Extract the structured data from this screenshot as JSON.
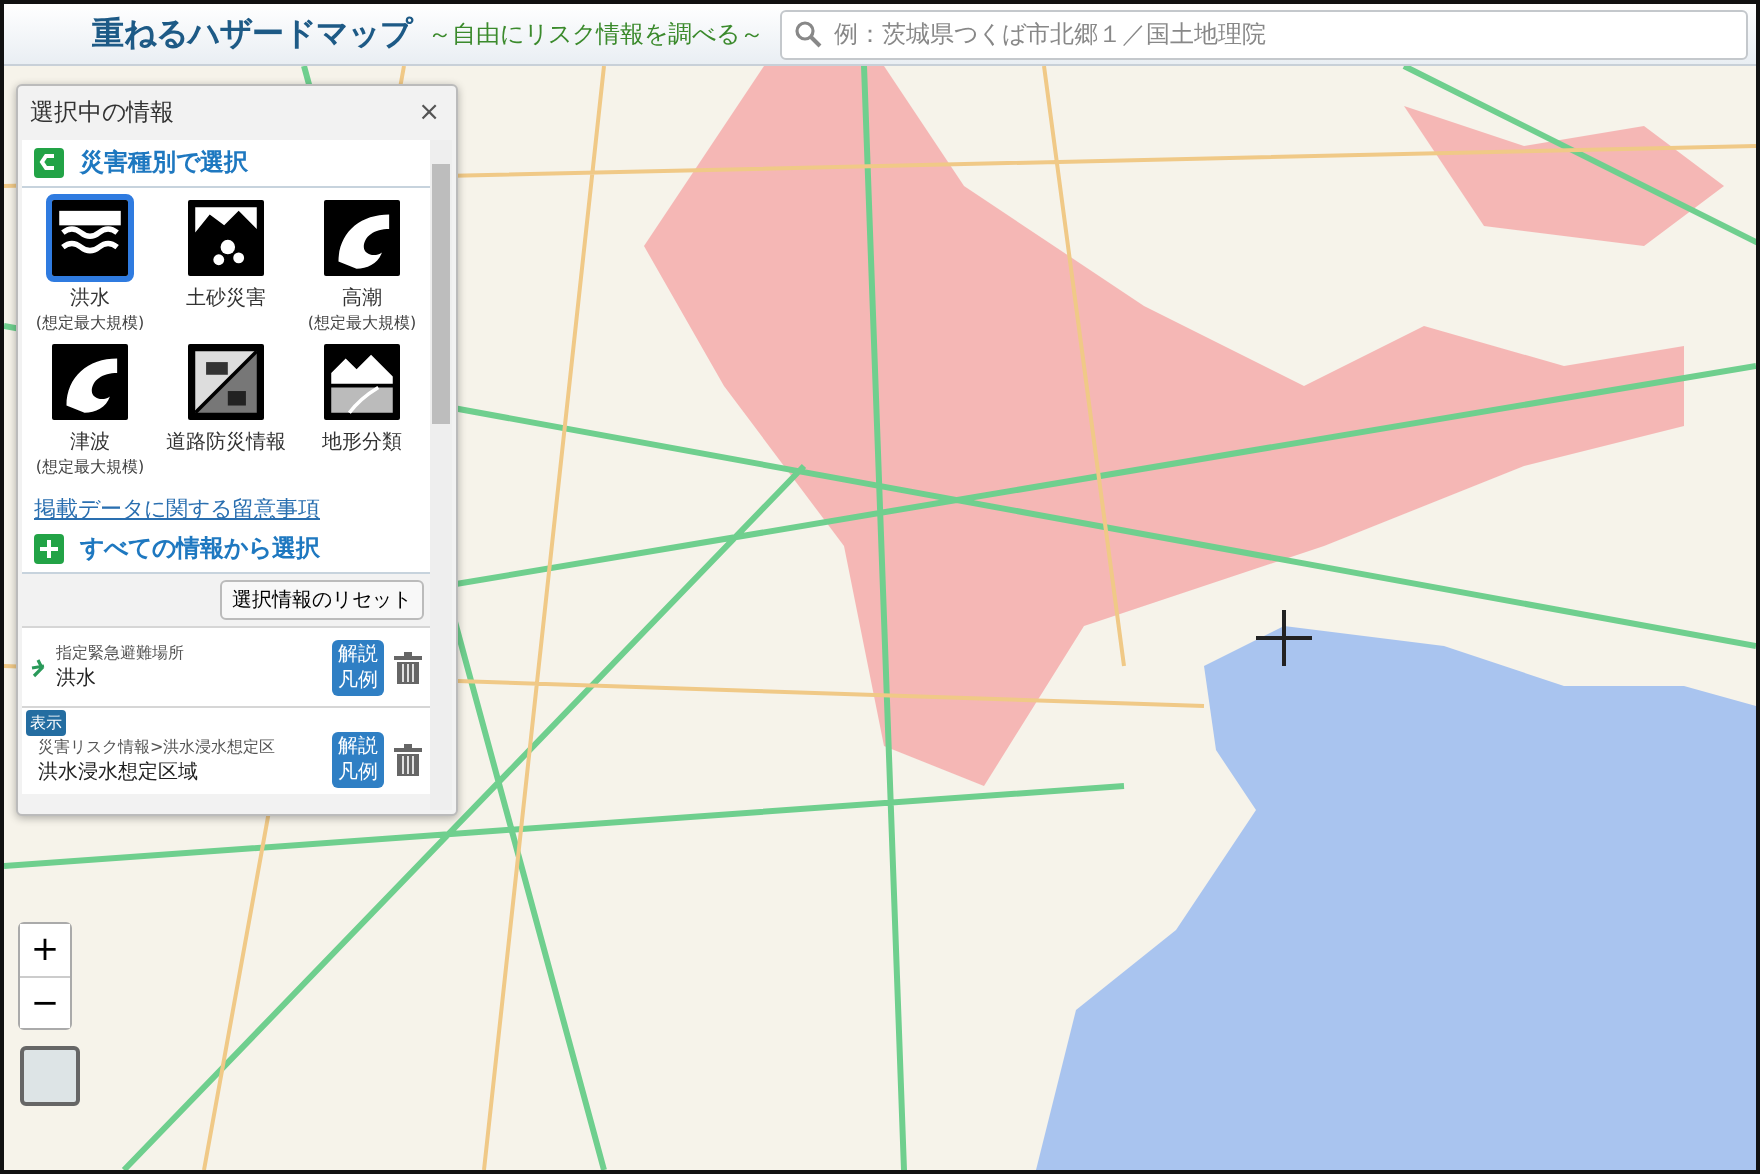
{
  "header": {
    "title": "重ねるハザードマップ",
    "subtitle": "～自由にリスク情報を調べる～",
    "search": {
      "placeholder": "例：茨城県つくば市北郷１／国土地理院"
    }
  },
  "panel": {
    "title": "選択中の情報",
    "close": "×",
    "hazard_section": {
      "title": "災害種別で選択"
    },
    "hazards": [
      {
        "kind": "flood",
        "label": "洪水",
        "note": "(想定最大規模)",
        "selected": true
      },
      {
        "kind": "landslide",
        "label": "土砂災害",
        "selected": false
      },
      {
        "kind": "storm-surge",
        "label": "高潮",
        "note": "(想定最大規模)",
        "selected": false
      },
      {
        "kind": "tsunami",
        "label": "津波",
        "note": "(想定最大規模)",
        "selected": false
      },
      {
        "kind": "road",
        "label": "道路防災情報",
        "selected": false
      },
      {
        "kind": "terrain",
        "label": "地形分類",
        "selected": false
      }
    ],
    "notice_link": "掲載データに関する留意事項",
    "all_section": {
      "title": "すべての情報から選択"
    },
    "reset_button": "選択情報のリセット",
    "layers": [
      {
        "category": "指定緊急避難場所",
        "name": "洪水",
        "legend_button": "解説凡例"
      },
      {
        "badge": "表示",
        "category": "災害リスク情報>洪水浸水想定区",
        "name": "洪水浸水想定区域",
        "legend_button": "解説凡例"
      }
    ]
  },
  "map_controls": {
    "zoom_in": "+",
    "zoom_out": "−"
  }
}
